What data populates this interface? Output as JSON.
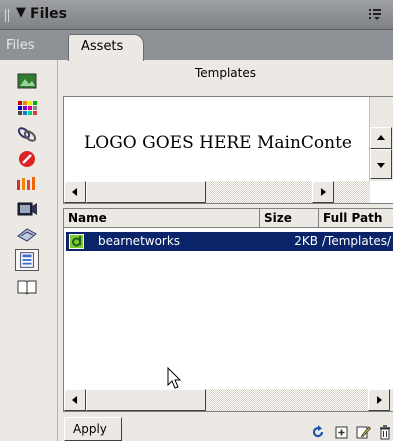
{
  "panel": {
    "title": "Files",
    "tabs": [
      {
        "label": "Files"
      },
      {
        "label": "Assets"
      }
    ]
  },
  "assets": {
    "section_title": "Templates",
    "preview_text": "LOGO GOES HERE MainConte",
    "columns": [
      "Name",
      "Size",
      "Full Path"
    ],
    "rows": [
      {
        "name": "bearnetworks",
        "size": "2KB",
        "path": "/Templates/"
      }
    ],
    "apply_label": "Apply"
  },
  "sidebar_icons": [
    "images-icon",
    "colors-icon",
    "urls-icon",
    "flash-icon",
    "shockwave-icon",
    "movies-icon",
    "scripts-icon",
    "templates-icon",
    "library-icon"
  ],
  "footer_icons": [
    "refresh-icon",
    "new-template-icon",
    "edit-icon",
    "delete-icon"
  ],
  "colors": {
    "selection": "#0a246a",
    "titlebar": "#8e9195"
  }
}
